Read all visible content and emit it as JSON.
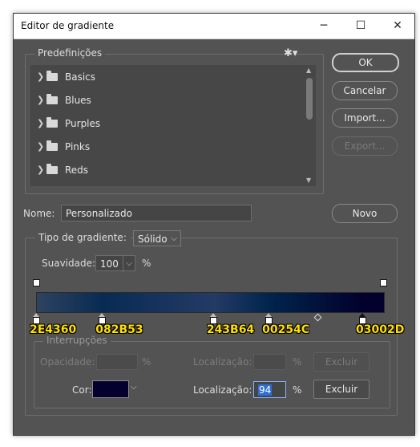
{
  "window": {
    "title": "Editor de gradiente",
    "minimize_glyph": "─",
    "maximize_glyph": "☐",
    "close_glyph": "✕"
  },
  "presets": {
    "legend": "Predefinições",
    "items": [
      {
        "label": "Basics"
      },
      {
        "label": "Blues"
      },
      {
        "label": "Purples"
      },
      {
        "label": "Pinks"
      },
      {
        "label": "Reds"
      }
    ]
  },
  "buttons": {
    "ok": "OK",
    "cancel": "Cancelar",
    "import": "Import...",
    "export": "Export...",
    "new": "Novo"
  },
  "name": {
    "label": "Nome:",
    "value": "Personalizado"
  },
  "gradient_type": {
    "label": "Tipo de gradiente:",
    "value": "Sólido"
  },
  "smoothness": {
    "label": "Suavidade:",
    "value": "100",
    "unit": "%"
  },
  "gradient": {
    "stops": [
      {
        "hex": "2E4360",
        "location": 0
      },
      {
        "hex": "082B53",
        "location": 19
      },
      {
        "hex": "243B64",
        "location": 51
      },
      {
        "hex": "00254C",
        "location": 67
      },
      {
        "hex": "03002D",
        "location": 94
      }
    ],
    "opacity_stops": [
      {
        "location": 0
      },
      {
        "location": 100
      }
    ],
    "midpoint_location": 81
  },
  "stops_panel": {
    "legend": "Interrupções",
    "opacity_label": "Opacidade:",
    "opacity_unit": "%",
    "location_label": "Localização:",
    "location_unit": "%",
    "delete_label": "Excluir",
    "color_label": "Cor:",
    "color_swatch": "#03002d",
    "color_location_value": "94"
  }
}
